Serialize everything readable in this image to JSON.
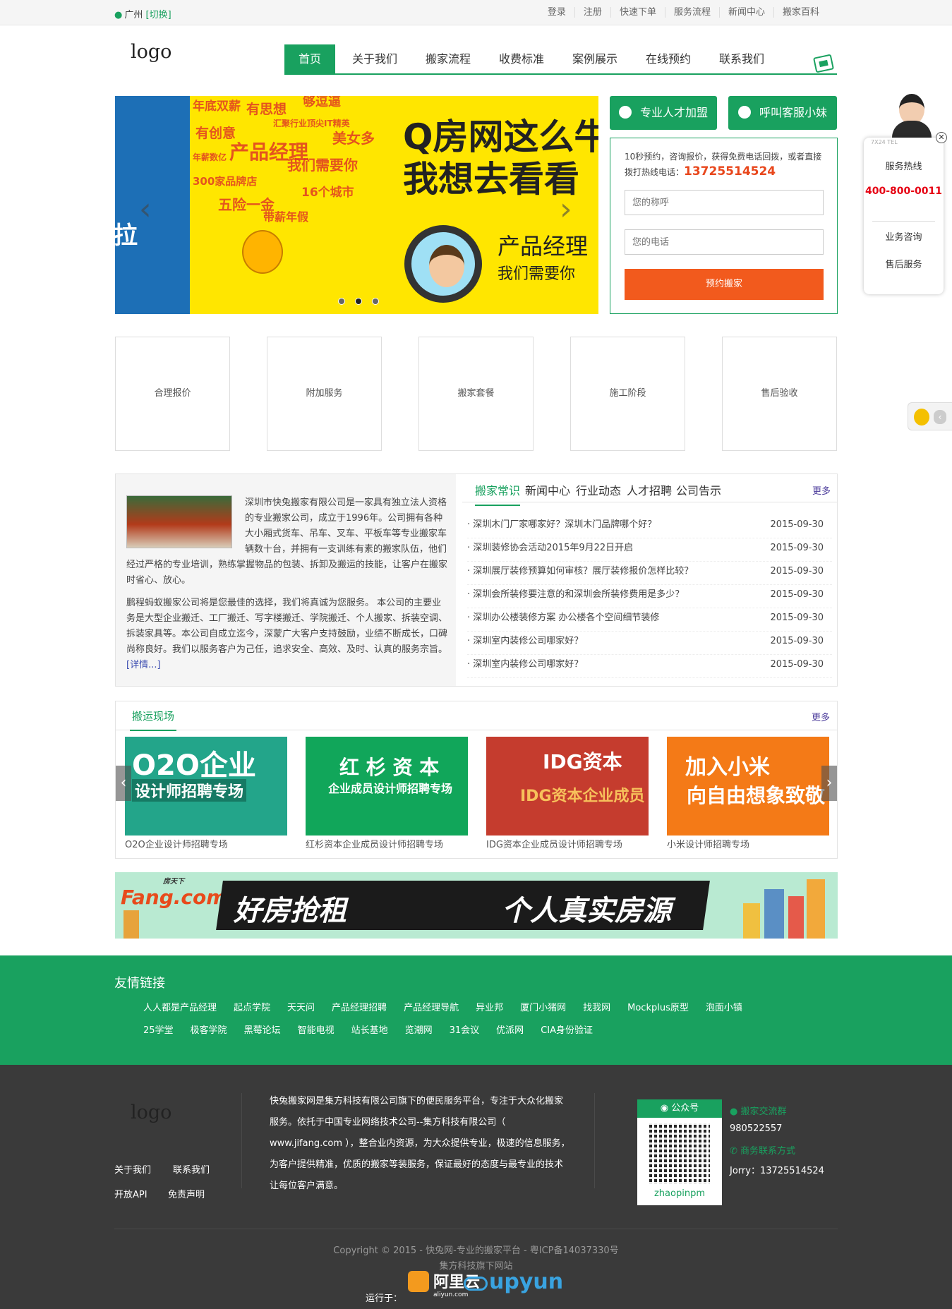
{
  "topbar": {
    "city": "广州",
    "switch": "[切换]",
    "links": [
      "登录",
      "注册",
      "快速下单",
      "服务流程",
      "新闻中心",
      "搬家百科"
    ]
  },
  "logo": "logo",
  "nav": [
    "首页",
    "关于我们",
    "搬家流程",
    "收费标准",
    "案例展示",
    "在线预约",
    "联系我们"
  ],
  "banner": {
    "words": [
      "年底双薪",
      "有思想",
      "够逗逼",
      "有创意",
      "汇聚行业顶尖IT精英",
      "产品经理",
      "美女多",
      "年薪数亿",
      "我们需要你",
      "300家品牌店",
      "五险一金",
      "16个城市",
      "带薪年假"
    ],
    "headline1": "Q房网这么牛",
    "headline2": "我想去看看",
    "role": "产品经理",
    "role2": "我们需要你",
    "side": "拉"
  },
  "buttons": {
    "join": "专业人才加盟",
    "service": "呼叫客服小妹"
  },
  "booking": {
    "intro": "10秒预约，咨询报价，获得免费电话回拨，或者直接拨打热线电话：",
    "hotline": "13725514524",
    "name_ph": "您的称呼",
    "phone_ph": "您的电话",
    "submit": "预约搬家"
  },
  "service_panel": {
    "tag": "7X24 TEL",
    "title": "服务热线",
    "phone": "400-800-0011",
    "item1": "业务咨询",
    "item2": "售后服务"
  },
  "features": [
    "合理报价",
    "附加服务",
    "搬家套餐",
    "施工阶段",
    "售后验收"
  ],
  "about": {
    "p1": "深圳市快兔搬家有限公司是一家具有独立法人资格的专业搬家公司，成立于1996年。公司拥有各种大小厢式货车、吊车、叉车、平板车等专业搬家车辆数十台，并拥有一支训练有素的搬家队伍，他们经过严格的专业培训，熟练掌握物品的包装、拆卸及搬运的技能，让客户在搬家时省心、放心。",
    "p2": "鹏程蚂蚁搬家公司将是您最佳的选择，我们将真诚为您服务。 本公司的主要业务是大型企业搬迁、工厂搬迁、写字楼搬迁、学院搬迁、个人搬家、拆装空调、拆装家具等。本公司自成立迄今，深蒙广大客户支持鼓励，业绩不断成长，口碑尚称良好。我们以服务客户为己任，追求安全、高效、及时、认真的服务宗旨。",
    "more": "[详情...]"
  },
  "tabs": {
    "items": [
      "搬家常识",
      "新闻中心",
      "行业动态",
      "人才招聘",
      "公司告示"
    ],
    "more": "更多"
  },
  "news": [
    {
      "title": "· 深圳木门厂家哪家好？深圳木门品牌哪个好？",
      "date": "2015-09-30"
    },
    {
      "title": "· 深圳装修协会活动2015年9月22日开启",
      "date": "2015-09-30"
    },
    {
      "title": "· 深圳展厅装修预算如何审核？展厅装修报价怎样比较？",
      "date": "2015-09-30"
    },
    {
      "title": "· 深圳会所装修要注意的和深圳会所装修费用是多少？",
      "date": "2015-09-30"
    },
    {
      "title": "· 深圳办公楼装修方案 办公楼各个空间细节装修",
      "date": "2015-09-30"
    },
    {
      "title": "· 深圳室内装修公司哪家好？",
      "date": "2015-09-30"
    },
    {
      "title": "· 深圳室内装修公司哪家好？",
      "date": "2015-09-30"
    }
  ],
  "scene": {
    "title": "搬运现场",
    "more": "更多",
    "cards": [
      {
        "l1": "O2O企业",
        "l2": "设计师招聘专场",
        "caption": "O2O企业设计师招聘专场"
      },
      {
        "l1": "红 杉 资 本",
        "l2": "企业成员设计师招聘专场",
        "caption": "红杉资本企业成员设计师招聘专场"
      },
      {
        "l1": "IDG资本",
        "l2": "IDG资本企业成员",
        "caption": "IDG资本企业成员设计师招聘专场"
      },
      {
        "l1": "加入小米",
        "l2": "向自由想象致敬",
        "caption": "小米设计师招聘专场"
      }
    ]
  },
  "ad": {
    "brand": "Fang.com",
    "brand_sub": "房天下",
    "t1": "好房抢租",
    "t2": "个人真实房源"
  },
  "links": {
    "title": "友情链接",
    "row1": [
      "人人都是产品经理",
      "起点学院",
      "天天问",
      "产品经理招聘",
      "产品经理导航",
      "异业邦",
      "厦门小猪网",
      "找我网",
      "Mockplus原型",
      "泡面小镇"
    ],
    "row2": [
      "25学堂",
      "极客学院",
      "黑莓论坛",
      "智能电视",
      "站长基地",
      "览潮网",
      "31会议",
      "优派网",
      "CIA身份验证"
    ]
  },
  "footer": {
    "logo": "logo",
    "about": "关于我们",
    "contact": "联系我们",
    "api": "开放API",
    "disclaimer": "免责声明",
    "desc": "快兔搬家网是集方科技有限公司旗下的便民服务平台，专注于大众化搬家服务。依托于中国专业网络技术公司--集方科技有限公司（ www.jifang.com ），整合业内资源，为大众提供专业，极速的信息服务，为客户提供精准，优质的搬家等装服务，保证最好的态度与最专业的技术让每位客户满意。",
    "qr_title": "公众号",
    "qr_name": "zhaopinpm",
    "group_label": "搬家交流群",
    "group_num": "980522557",
    "biz_label": "商务联系方式",
    "biz_contact": "Jorry：13725514524",
    "copyright": "Copyright © 2015 - 快兔网-专业的搬家平台 - 粤ICP备14037330号",
    "sub": "集方科技旗下网站",
    "run": "运行于：",
    "aliyun": "阿里云",
    "aliyun_sub": "aliyun.com",
    "upyun": "upyun"
  }
}
